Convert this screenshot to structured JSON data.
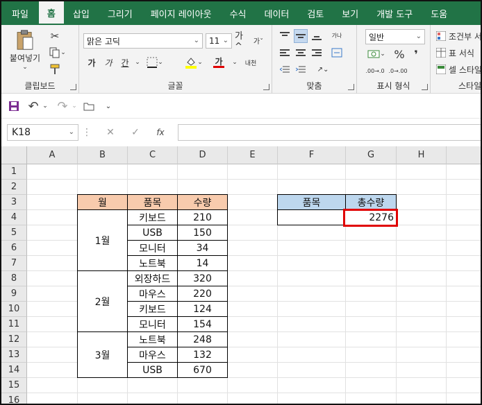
{
  "ribbon_tabs": [
    "파일",
    "홈",
    "삽입",
    "그리기",
    "페이지 레이아웃",
    "수식",
    "데이터",
    "검토",
    "보기",
    "개발 도구",
    "도움"
  ],
  "active_tab": "홈",
  "clipboard": {
    "paste_label": "붙여넣기",
    "group_label": "클립보드"
  },
  "font": {
    "name": "맑은 고딕",
    "size": "11",
    "group_label": "글꼴",
    "bold": "가",
    "italic": "가",
    "underline": "간",
    "font_color_letter": "가",
    "phonetic": "내천"
  },
  "alignment": {
    "group_label": "맞춤",
    "wrap": "가나"
  },
  "number": {
    "format": "일반",
    "group_label": "표시 형식",
    "percent": "%",
    "comma": "❜",
    "inc_decimal": ".00→.0",
    "dec_decimal": ".0→.00"
  },
  "styles": {
    "conditional": "조건부 서",
    "table": "표 서식",
    "cell": "셀 스타일",
    "group_label": "스타일"
  },
  "colors": {
    "brand": "#217346",
    "header_orange": "#f8cbad",
    "header_blue": "#bdd7ee",
    "highlight_red": "#e00000"
  },
  "name_box": "K18",
  "fx_label": "fx",
  "formula": "",
  "columns": [
    "A",
    "B",
    "C",
    "D",
    "E",
    "F",
    "G",
    "H"
  ],
  "rows": [
    "1",
    "2",
    "3",
    "4",
    "5",
    "6",
    "7",
    "8",
    "9",
    "10",
    "11",
    "12",
    "13",
    "14",
    "15",
    "16"
  ],
  "table1": {
    "headers": [
      "월",
      "품목",
      "수량"
    ],
    "groups": [
      {
        "month": "1월",
        "items": [
          {
            "name": "키보드",
            "qty": "210"
          },
          {
            "name": "USB",
            "qty": "150"
          },
          {
            "name": "모니터",
            "qty": "34"
          },
          {
            "name": "노트북",
            "qty": "14"
          }
        ]
      },
      {
        "month": "2월",
        "items": [
          {
            "name": "외장하드",
            "qty": "320"
          },
          {
            "name": "마우스",
            "qty": "220"
          },
          {
            "name": "키보드",
            "qty": "124"
          },
          {
            "name": "모니터",
            "qty": "154"
          }
        ]
      },
      {
        "month": "3월",
        "items": [
          {
            "name": "노트북",
            "qty": "248"
          },
          {
            "name": "마우스",
            "qty": "132"
          },
          {
            "name": "USB",
            "qty": "670"
          }
        ]
      }
    ]
  },
  "table2": {
    "headers": [
      "품목",
      "총수량"
    ],
    "item": "",
    "total": "2276"
  }
}
